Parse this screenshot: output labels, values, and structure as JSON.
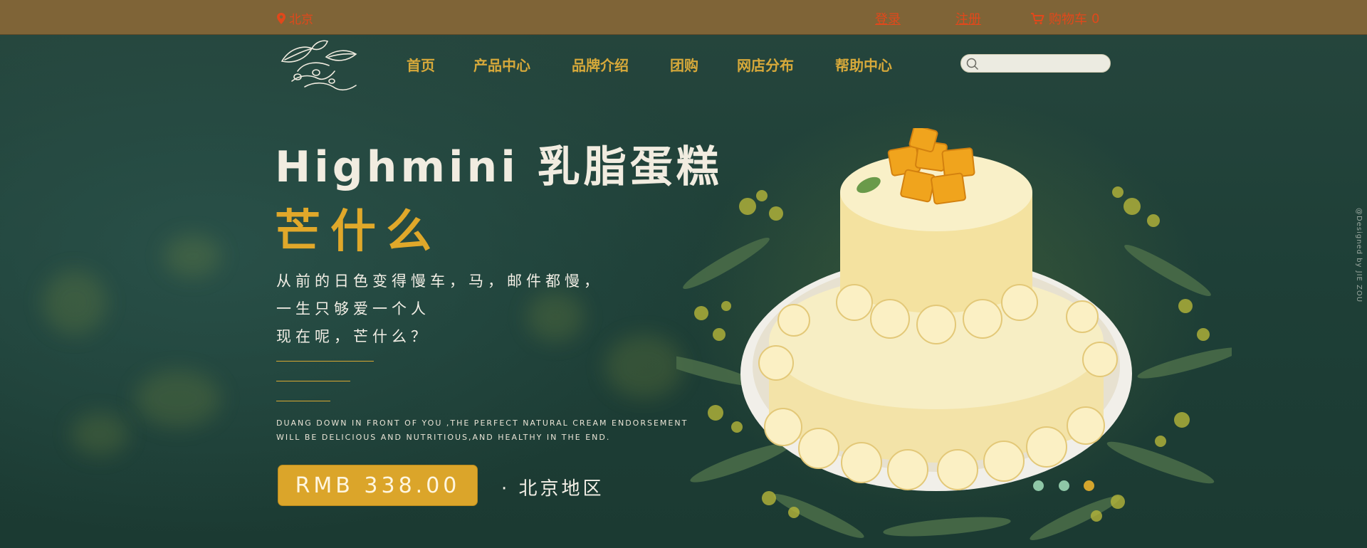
{
  "topbar": {
    "location": "北京",
    "login": "登录",
    "register": "注册",
    "cart_label": "购物车",
    "cart_count": "0"
  },
  "nav": {
    "items": [
      {
        "label": "首页"
      },
      {
        "label": "产品中心"
      },
      {
        "label": "品牌介绍"
      },
      {
        "label": "团购"
      },
      {
        "label": "网店分布"
      },
      {
        "label": "帮助中心"
      }
    ],
    "search_placeholder": ""
  },
  "hero": {
    "title": "Highmini 乳脂蛋糕",
    "subtitle": "芒什么",
    "poem": [
      "从前的日色变得慢车，马，邮件都慢，",
      "一生只够爱一个人",
      "现在呢，芒什么？"
    ],
    "english": [
      "DUANG DOWN IN FRONT OF YOU ,THE PERFECT NATURAL CREAM ENDORSEMENT",
      "WILL BE DELICIOUS AND NUTRITIOUS,AND HEALTHY IN THE END."
    ],
    "price": "RMB  338.00",
    "region": "· 北京地区"
  },
  "carousel": {
    "slide_count": 3,
    "active_index": 2
  },
  "credit": "@Designed by JIE ZOU",
  "colors": {
    "topbar_bg": "#7f6437",
    "accent_gold": "#e0a82a",
    "top_link": "#e1481b",
    "background": "#1f3d35",
    "dot_inactive": "#8fc7a7",
    "dot_active": "#d4a52d"
  },
  "icons": {
    "location": "map-pin-icon",
    "cart": "shopping-cart-icon",
    "search": "search-icon",
    "logo": "leaf-logo"
  }
}
